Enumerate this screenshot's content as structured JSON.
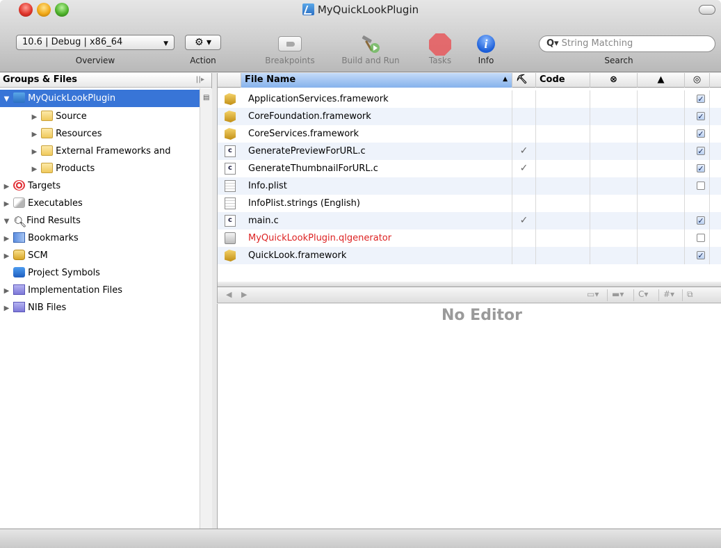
{
  "window": {
    "title": "MyQuickLookPlugin"
  },
  "toolbar": {
    "overview_value": "10.6 | Debug | x86_64",
    "overview_label": "Overview",
    "action_label": "Action",
    "breakpoints_label": "Breakpoints",
    "build_run_label": "Build and Run",
    "tasks_label": "Tasks",
    "info_label": "Info",
    "search_placeholder": "String Matching",
    "search_label": "Search"
  },
  "sidebar": {
    "header": "Groups & Files",
    "items": [
      {
        "label": "MyQuickLookPlugin",
        "icon": "project-icon",
        "disclosure": "▼",
        "selected": true
      },
      {
        "label": "Source",
        "icon": "folder-icon",
        "disclosure": "▶"
      },
      {
        "label": "Resources",
        "icon": "folder-icon",
        "disclosure": "▶"
      },
      {
        "label": "External Frameworks and",
        "icon": "folder-icon",
        "disclosure": "▶"
      },
      {
        "label": "Products",
        "icon": "folder-icon",
        "disclosure": "▶"
      },
      {
        "label": "Targets",
        "icon": "target-icon",
        "disclosure": "▶"
      },
      {
        "label": "Executables",
        "icon": "executable-icon",
        "disclosure": "▶"
      },
      {
        "label": "Find Results",
        "icon": "magnifier-icon",
        "disclosure": "▼"
      },
      {
        "label": "Bookmarks",
        "icon": "bookmark-icon",
        "disclosure": "▶"
      },
      {
        "label": "SCM",
        "icon": "scm-icon",
        "disclosure": "▶"
      },
      {
        "label": "Project Symbols",
        "icon": "symbols-icon",
        "disclosure": ""
      },
      {
        "label": "Implementation Files",
        "icon": "smart-group-icon",
        "disclosure": "▶"
      },
      {
        "label": "NIB Files",
        "icon": "smart-group-icon",
        "disclosure": "▶"
      }
    ]
  },
  "filelist": {
    "columns": {
      "file_name": "File Name",
      "build": "⛏",
      "code": "Code",
      "errors": "⊗",
      "warnings": "▲",
      "target": "◎"
    },
    "rows": [
      {
        "name": "ApplicationServices.framework",
        "icon": "framework-icon",
        "built": "",
        "checked": true
      },
      {
        "name": "CoreFoundation.framework",
        "icon": "framework-icon",
        "built": "",
        "checked": true
      },
      {
        "name": "CoreServices.framework",
        "icon": "framework-icon",
        "built": "",
        "checked": true
      },
      {
        "name": "GeneratePreviewForURL.c",
        "icon": "c-file-icon",
        "built": "✓",
        "checked": true
      },
      {
        "name": "GenerateThumbnailForURL.c",
        "icon": "c-file-icon",
        "built": "✓",
        "checked": true
      },
      {
        "name": "Info.plist",
        "icon": "plist-icon",
        "built": "",
        "checked": false
      },
      {
        "name": "InfoPlist.strings (English)",
        "icon": "plist-icon",
        "built": "",
        "checked": null
      },
      {
        "name": "main.c",
        "icon": "c-file-icon",
        "built": "✓",
        "checked": true
      },
      {
        "name": "MyQuickLookPlugin.qlgenerator",
        "icon": "bundle-icon",
        "built": "",
        "checked": false,
        "color": "#d22222"
      },
      {
        "name": "QuickLook.framework",
        "icon": "framework-icon",
        "built": "",
        "checked": true
      }
    ]
  },
  "editor": {
    "nav_back": "◀",
    "nav_forward": "▶",
    "placeholder": "No Editor"
  },
  "colors": {
    "selection": "#3875d7",
    "missing_file": "#d22222"
  }
}
